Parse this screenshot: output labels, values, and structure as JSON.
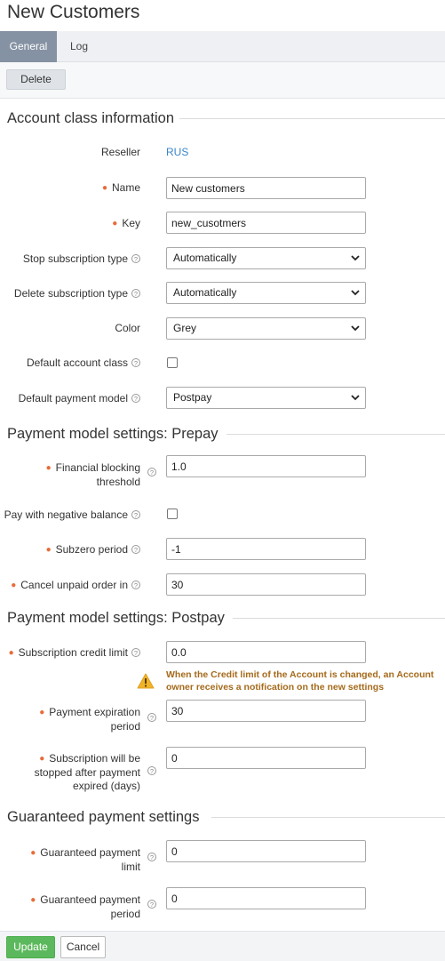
{
  "page": {
    "title": "New Customers"
  },
  "tabs": [
    {
      "label": "General",
      "active": true
    },
    {
      "label": "Log",
      "active": false
    }
  ],
  "toolbar": {
    "delete_label": "Delete"
  },
  "sections": {
    "account": "Account class information",
    "prepay": "Payment model settings: Prepay",
    "postpay": "Payment model settings: Postpay",
    "guaranteed": "Guaranteed payment settings"
  },
  "fields": {
    "reseller": {
      "label": "Reseller",
      "value": "RUS"
    },
    "name": {
      "label": "Name",
      "value": "New customers",
      "required": true
    },
    "key": {
      "label": "Key",
      "value": "new_cusotmers",
      "required": true
    },
    "stop_subscription_type": {
      "label": "Stop subscription type",
      "value": "Automatically"
    },
    "delete_subscription_type": {
      "label": "Delete subscription type",
      "value": "Automatically"
    },
    "color": {
      "label": "Color",
      "value": "Grey"
    },
    "default_account_class": {
      "label": "Default account class",
      "checked": false
    },
    "default_payment_model": {
      "label": "Default payment model",
      "value": "Postpay"
    },
    "financial_blocking_threshold": {
      "label": "Financial blocking threshold",
      "value": "1.0",
      "required": true
    },
    "pay_with_negative_balance": {
      "label": "Pay with negative balance",
      "checked": false
    },
    "subzero_period": {
      "label": "Subzero period",
      "value": "-1",
      "required": true
    },
    "cancel_unpaid_order_in": {
      "label": "Cancel unpaid order in",
      "value": "30",
      "required": true
    },
    "subscription_credit_limit": {
      "label": "Subscription credit limit",
      "value": "0.0",
      "required": true
    },
    "payment_expiration_period": {
      "label": "Payment expiration period",
      "value": "30",
      "required": true
    },
    "subscription_stopped_after": {
      "label": "Subscription will be stopped after payment expired (days)",
      "value": "0",
      "required": true
    },
    "guaranteed_payment_limit": {
      "label": "Guaranteed payment limit",
      "value": "0",
      "required": true
    },
    "guaranteed_payment_period": {
      "label": "Guaranteed payment period",
      "value": "0",
      "required": true
    }
  },
  "warning": {
    "text": "When the Credit limit of the Account is changed, an Account owner receives a notification on the new settings",
    "icon": "warning-icon"
  },
  "footer": {
    "update_label": "Update",
    "cancel_label": "Cancel"
  },
  "colors": {
    "accent": "#8592a3",
    "required": "#e96b3a",
    "link": "#3a86c8",
    "update": "#5cb85c",
    "warning": "#a56a1b"
  }
}
